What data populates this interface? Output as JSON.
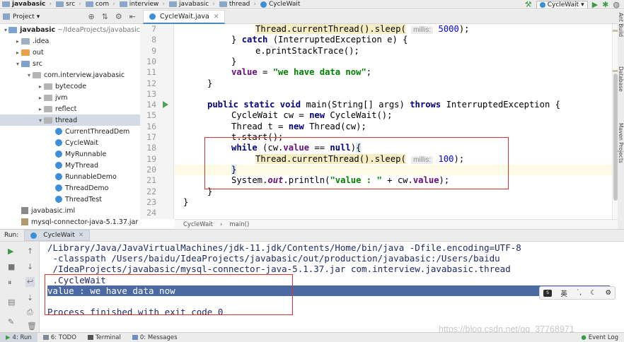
{
  "navbar": {
    "crumbs": [
      "javabasic",
      "src",
      "com",
      "interview",
      "javabasic",
      "thread",
      "CycleWait"
    ],
    "run_config": "CycleWait"
  },
  "project_panel": {
    "title": "Project",
    "tree": [
      {
        "label": "javabasic",
        "path": "~/IdeaProjects/javabasic",
        "indent": 0,
        "arrow": "▾",
        "icon": "folder-blue"
      },
      {
        "label": ".idea",
        "indent": 1,
        "arrow": "▸",
        "icon": "folder-gray"
      },
      {
        "label": "out",
        "indent": 1,
        "arrow": "▸",
        "icon": "folder-orange"
      },
      {
        "label": "src",
        "indent": 1,
        "arrow": "▾",
        "icon": "folder-blue"
      },
      {
        "label": "com.interview.javabasic",
        "indent": 2,
        "arrow": "▾",
        "icon": "package"
      },
      {
        "label": "bytecode",
        "indent": 3,
        "arrow": "▸",
        "icon": "package"
      },
      {
        "label": "jvm",
        "indent": 3,
        "arrow": "▸",
        "icon": "package"
      },
      {
        "label": "reflect",
        "indent": 3,
        "arrow": "▸",
        "icon": "package"
      },
      {
        "label": "thread",
        "indent": 3,
        "arrow": "▾",
        "icon": "package",
        "selected": true
      },
      {
        "label": "CurrentThreadDem",
        "indent": 4,
        "arrow": "",
        "icon": "class"
      },
      {
        "label": "CycleWait",
        "indent": 4,
        "arrow": "",
        "icon": "class"
      },
      {
        "label": "MyRunnable",
        "indent": 4,
        "arrow": "",
        "icon": "class"
      },
      {
        "label": "MyThread",
        "indent": 4,
        "arrow": "",
        "icon": "class"
      },
      {
        "label": "RunnableDemo",
        "indent": 4,
        "arrow": "",
        "icon": "class"
      },
      {
        "label": "ThreadDemo",
        "indent": 4,
        "arrow": "",
        "icon": "class"
      },
      {
        "label": "ThreadTest",
        "indent": 4,
        "arrow": "",
        "icon": "class"
      },
      {
        "label": "javabasic.iml",
        "indent": 1,
        "arrow": "",
        "icon": "iml"
      },
      {
        "label": "mysql-connector-java-5.1.37.jar",
        "indent": 1,
        "arrow": "",
        "icon": "jar"
      }
    ]
  },
  "editor": {
    "tab_label": "CycleWait.java",
    "line_numbers": [
      "7",
      "8",
      "9",
      "10",
      "11",
      "12",
      "13",
      "14",
      "15",
      "16",
      "17",
      "18",
      "19",
      "20",
      "21",
      "22",
      "23",
      "24"
    ],
    "code": {
      "l7_call": "Thread.currentThread().sleep(",
      "l7_hint": "millis:",
      "l7_num": "5000",
      "l7_tail": ");",
      "l8_brace": "} ",
      "l8_kw": "catch",
      "l8_rest": " (InterruptedException e) {",
      "l9": "e.printStackTrace();",
      "l10": "}",
      "l11_field": "value",
      "l11_eq": " = ",
      "l11_str": "\"we have data now\"",
      "l11_end": ";",
      "l12": "}",
      "l14_kw1": "public",
      "l14_kw2": "static",
      "l14_kw3": "void",
      "l14_mid": " main(String[] args) ",
      "l14_kw4": "throws",
      "l14_tail": " InterruptedException {",
      "l15_a": "CycleWait cw = ",
      "l15_kw": "new",
      "l15_b": " CycleWait();",
      "l16_a": "Thread t = ",
      "l16_kw": "new",
      "l16_b": " Thread(cw);",
      "l17": "t.start();",
      "l18_kw": "while",
      "l18_a": " (cw.",
      "l18_field": "value",
      "l18_b": " == ",
      "l18_null": "null",
      "l18_c": ")",
      "l18_brace": "{",
      "l19_call": "Thread.currentThread().sleep(",
      "l19_hint": "millis:",
      "l19_num": "100",
      "l19_tail": ");",
      "l20": "}",
      "l21_a": "System.",
      "l21_out": "out",
      "l21_b": ".println(",
      "l21_str": "\"value : \"",
      "l21_c": " + cw.",
      "l21_field": "value",
      "l21_d": ");",
      "l22": "}",
      "l23": "}"
    },
    "breadcrumb": [
      "CycleWait",
      "main()"
    ]
  },
  "right_strip": [
    "Ant Build",
    "Database",
    "Maven Projects"
  ],
  "run_panel": {
    "label": "Run:",
    "tab": "CycleWait",
    "console": [
      "/Library/Java/JavaVirtualMachines/jdk-11.jdk/Contents/Home/bin/java -Dfile.encoding=UTF-8",
      " -classpath /Users/baidu/IdeaProjects/javabasic/out/production/javabasic:/Users/baidu",
      " /IdeaProjects/javabasic/mysql-connector-java-5.1.37.jar com.interview.javabasic.thread",
      " .CycleWait",
      "value : we have data now",
      "",
      "Process finished with exit code 0"
    ]
  },
  "ime_bar": {
    "lang": "英"
  },
  "watermark": "https://blog.csdn.net/qq_37768971",
  "statusbar": {
    "items": [
      "4: Run",
      "6: TODO",
      "Terminal",
      "0: Messages"
    ],
    "event_log": "Event Log"
  }
}
